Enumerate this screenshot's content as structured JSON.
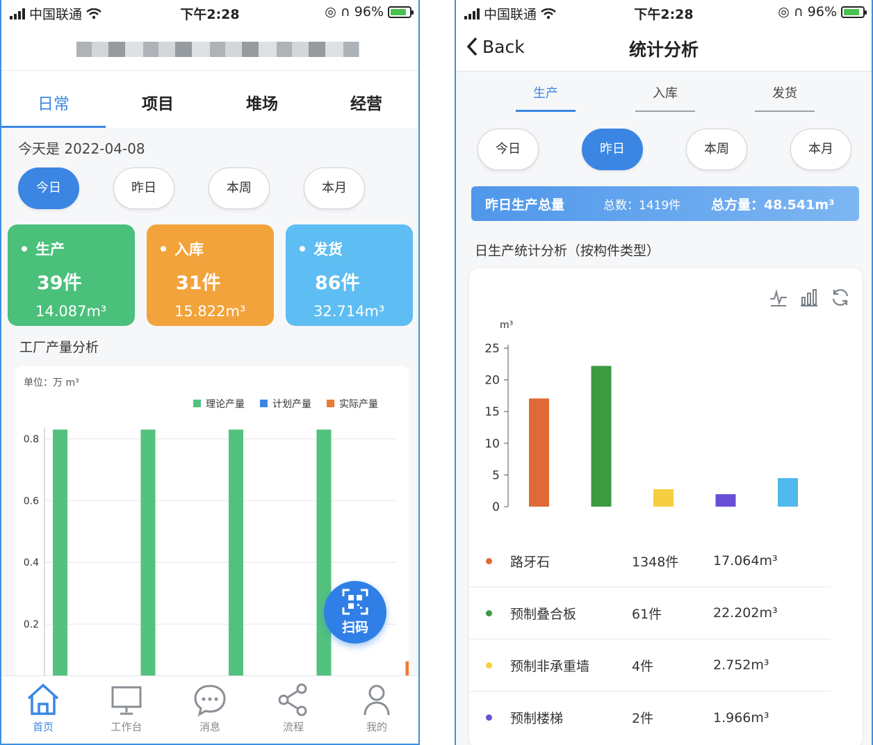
{
  "status_bar": {
    "carrier": "中国联通",
    "time": "下午2:28",
    "battery": "96%"
  },
  "left": {
    "tabs": [
      "日常",
      "项目",
      "堆场",
      "经营"
    ],
    "today_label": "今天是 2022-04-08",
    "filters": [
      "今日",
      "昨日",
      "本周",
      "本月"
    ],
    "cards": [
      {
        "title": "生产",
        "count": "39件",
        "volume": "14.087m³",
        "color": "#4ac07a"
      },
      {
        "title": "入库",
        "count": "31件",
        "volume": "15.822m³",
        "color": "#f2a33b"
      },
      {
        "title": "发货",
        "count": "86件",
        "volume": "32.714m³",
        "color": "#5ebdf2"
      }
    ],
    "factory_title": "工厂产量分析",
    "scan_label": "扫码",
    "bottom_nav": [
      "首页",
      "工作台",
      "消息",
      "流程",
      "我的"
    ]
  },
  "right": {
    "back_label": "Back",
    "title": "统计分析",
    "tabs": [
      "生产",
      "入库",
      "发货"
    ],
    "filters": [
      "今日",
      "昨日",
      "本周",
      "本月"
    ],
    "banner": {
      "label": "昨日生产总量",
      "total": "总数：1419件",
      "volume": "总方量：48.541m³"
    },
    "section_title": "日生产统计分析（按构件类型）",
    "items": [
      {
        "name": "路牙石",
        "count": "1348件",
        "volume": "17.064m³",
        "color": "#e06a36"
      },
      {
        "name": "预制叠合板",
        "count": "61件",
        "volume": "22.202m³",
        "color": "#3c9a40"
      },
      {
        "name": "预制非承重墙",
        "count": "4件",
        "volume": "2.752m³",
        "color": "#f5cf3f"
      },
      {
        "name": "预制楼梯",
        "count": "2件",
        "volume": "1.966m³",
        "color": "#6a4fd6"
      }
    ]
  },
  "chart_data": [
    {
      "type": "bar",
      "unit_label": "单位：万 m³",
      "legend": [
        "理论产量",
        "计划产量",
        "实际产量"
      ],
      "series_colors": [
        "#52c27e",
        "#3b86e3",
        "#ef7a34"
      ],
      "y_ticks": [
        "0.2",
        "0.4",
        "0.6",
        "0.8"
      ],
      "ylim": [
        0,
        0.9
      ],
      "series": [
        {
          "name": "理论产量",
          "values": [
            0.83,
            0.83,
            0.83,
            0.83,
            0
          ]
        },
        {
          "name": "计划产量",
          "values": [
            0,
            0,
            0,
            0,
            0
          ]
        },
        {
          "name": "实际产量",
          "values": [
            0.005,
            0,
            0,
            0.08,
            0.015
          ]
        }
      ]
    },
    {
      "type": "bar",
      "ylabel": "m³",
      "y_ticks": [
        "0",
        "5",
        "10",
        "15",
        "20",
        "25"
      ],
      "ylim": [
        0,
        25
      ],
      "values": [
        17.064,
        22.202,
        2.752,
        1.966,
        4.5
      ],
      "colors": [
        "#e06a36",
        "#3c9a40",
        "#f5cf3f",
        "#6a4fd6",
        "#4fb8ec"
      ]
    }
  ]
}
